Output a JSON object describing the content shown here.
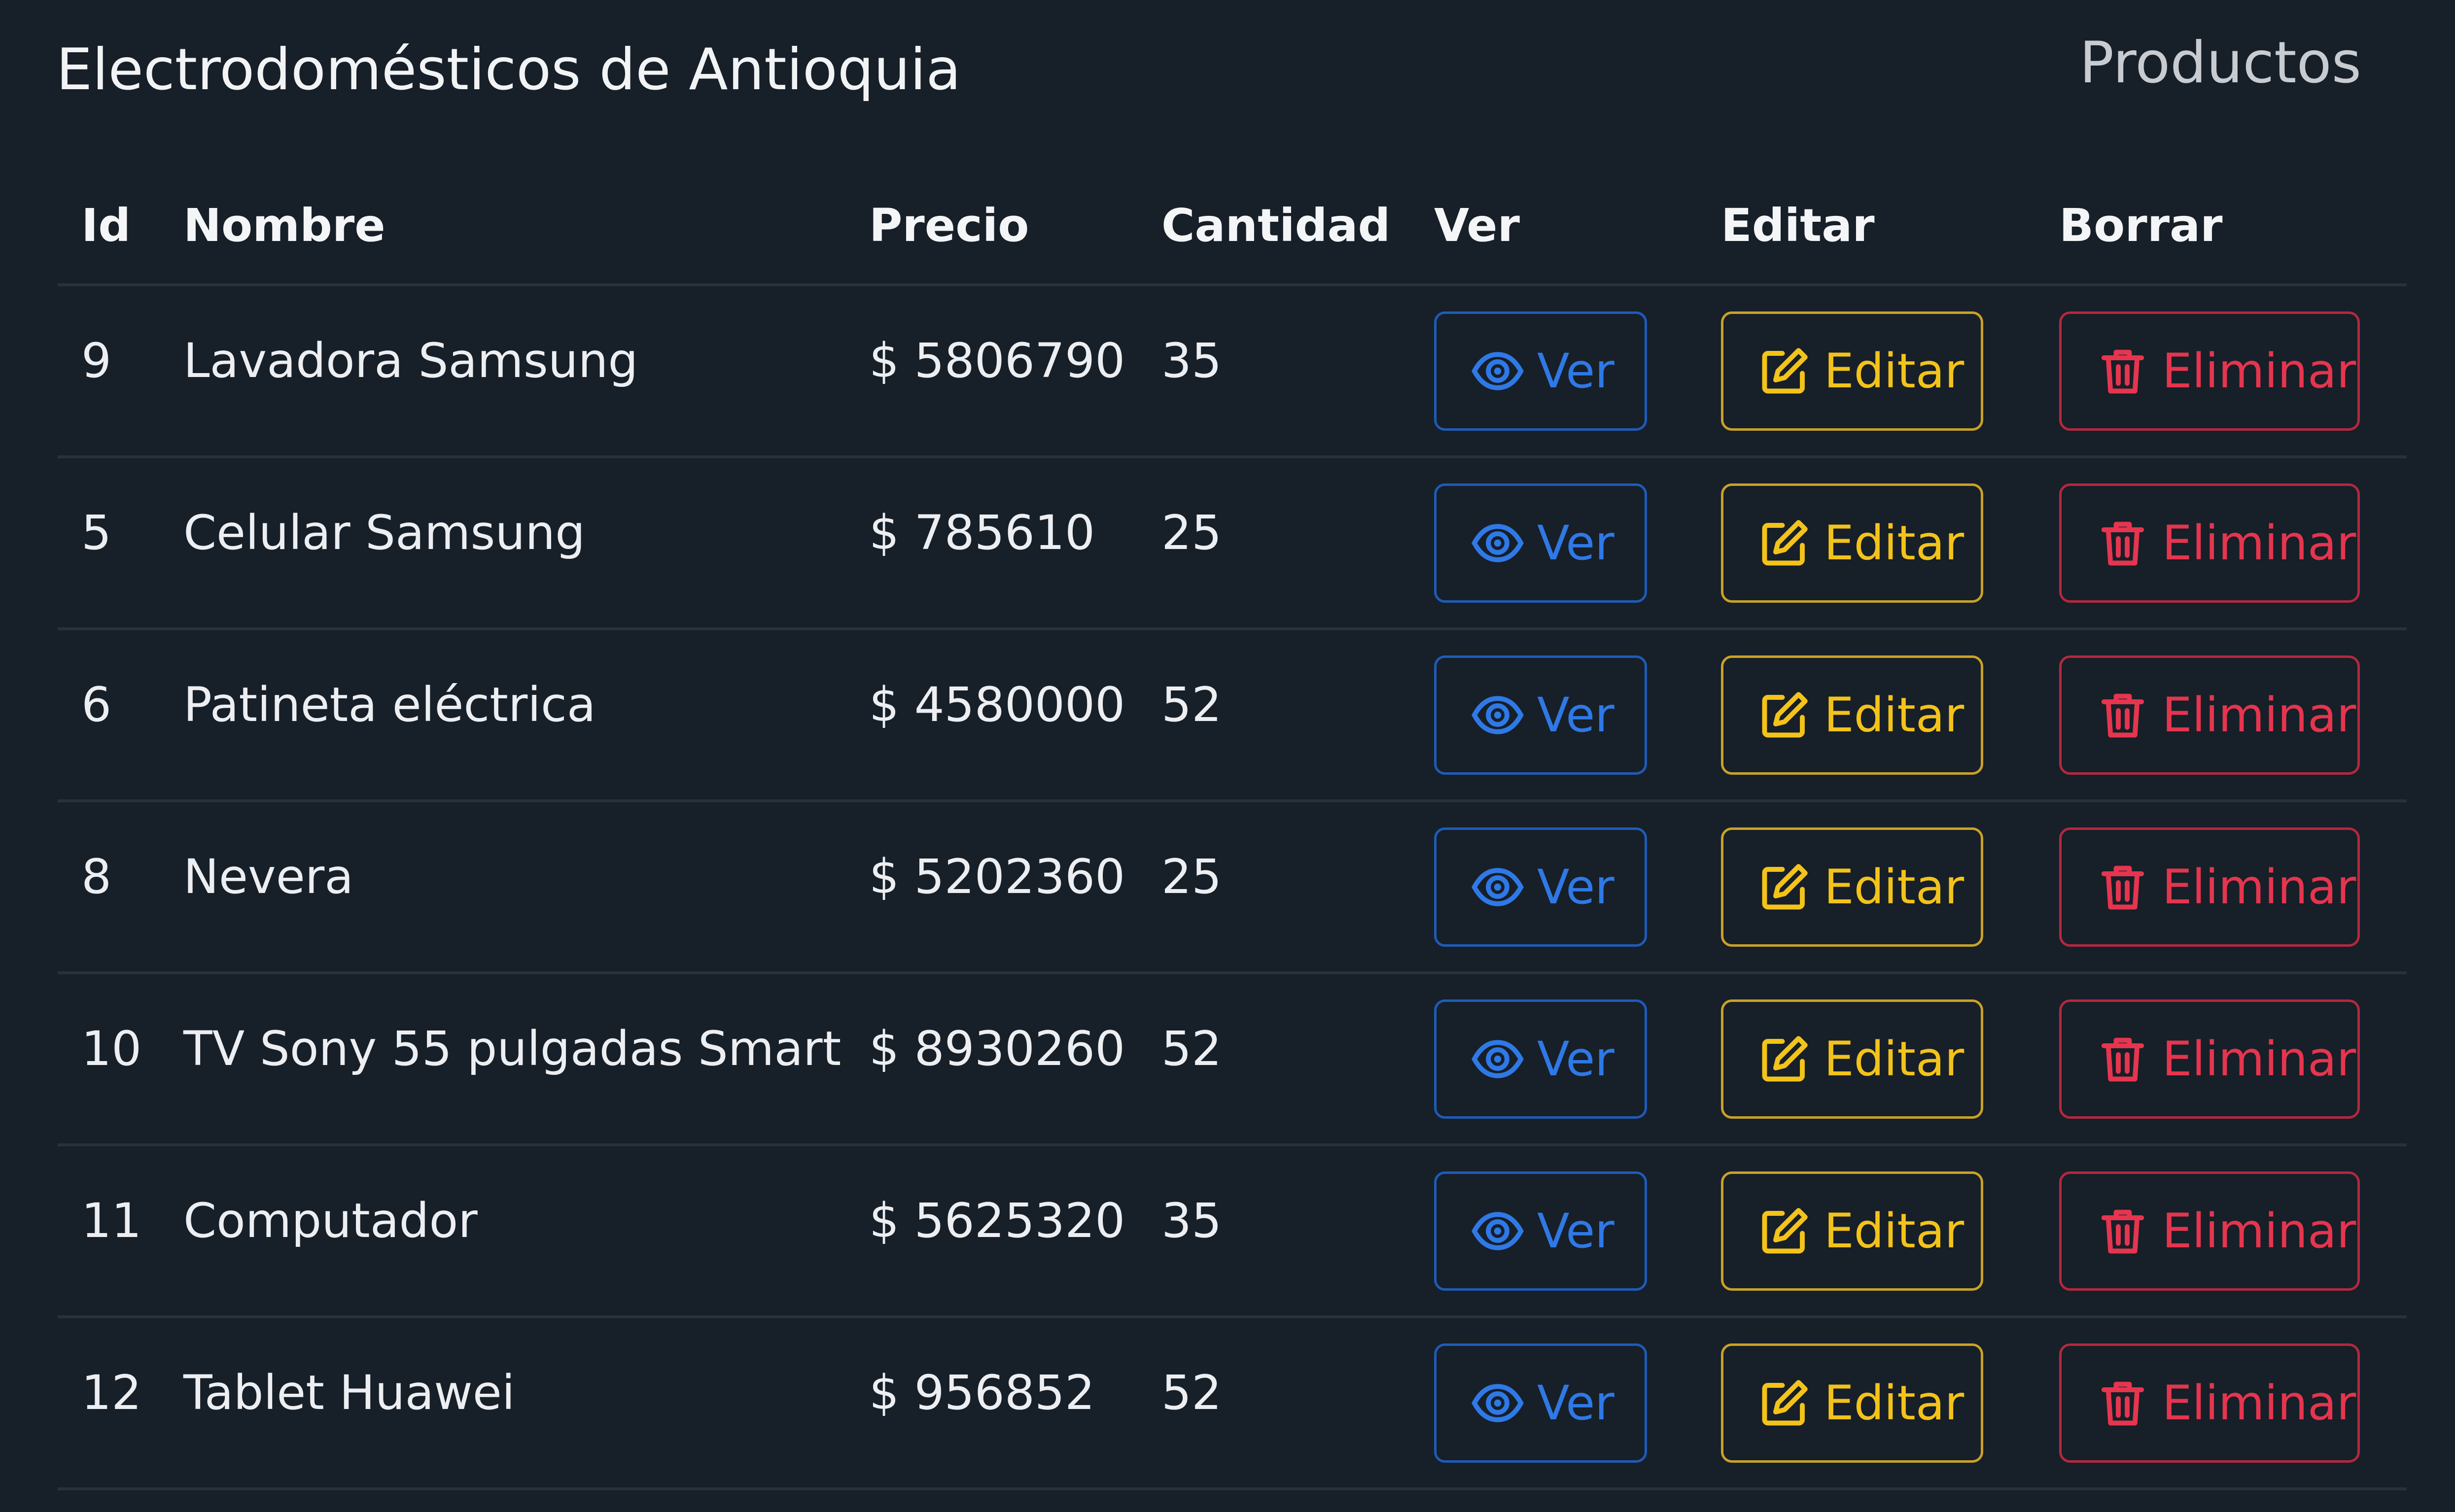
{
  "navbar": {
    "brand": "Electrodomésticos de Antioquia",
    "link": "Productos"
  },
  "table": {
    "headers": {
      "id": "Id",
      "nombre": "Nombre",
      "precio": "Precio",
      "cantidad": "Cantidad",
      "ver": "Ver",
      "editar": "Editar",
      "borrar": "Borrar"
    },
    "buttons": {
      "ver": "Ver",
      "editar": "Editar",
      "eliminar": "Eliminar"
    },
    "icons": {
      "ver": "eye-icon",
      "editar": "pencil-square-icon",
      "eliminar": "trash-icon"
    },
    "colors": {
      "background": "#171f28",
      "ver": "#2f79e6",
      "editar": "#f3c31a",
      "eliminar": "#e5354f"
    },
    "rows": [
      {
        "id": "9",
        "nombre": "Lavadora Samsung",
        "precio": "$ 5806790",
        "cantidad": "35"
      },
      {
        "id": "5",
        "nombre": "Celular Samsung",
        "precio": "$ 785610",
        "cantidad": "25"
      },
      {
        "id": "6",
        "nombre": "Patineta eléctrica",
        "precio": "$ 4580000",
        "cantidad": "52"
      },
      {
        "id": "8",
        "nombre": "Nevera",
        "precio": "$ 5202360",
        "cantidad": "25"
      },
      {
        "id": "10",
        "nombre": "TV Sony 55 pulgadas Smart",
        "precio": "$ 8930260",
        "cantidad": "52"
      },
      {
        "id": "11",
        "nombre": "Computador",
        "precio": "$ 5625320",
        "cantidad": "35"
      },
      {
        "id": "12",
        "nombre": "Tablet Huawei",
        "precio": "$ 956852",
        "cantidad": "52"
      }
    ]
  }
}
